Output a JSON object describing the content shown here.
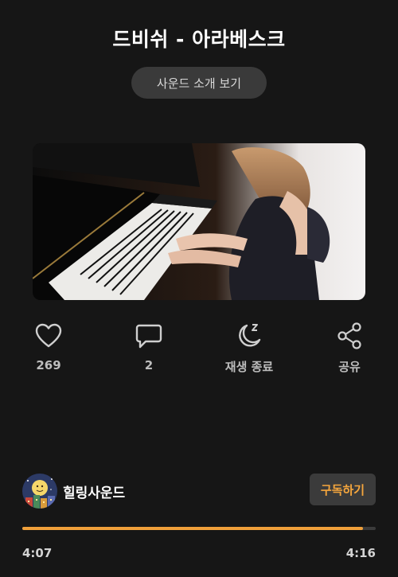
{
  "track": {
    "title": "드비쉬 - 아라베스크"
  },
  "intro_button": {
    "label": "사운드 소개 보기"
  },
  "actions": [
    {
      "icon": "heart-icon",
      "label": "269"
    },
    {
      "icon": "comment-icon",
      "label": "2"
    },
    {
      "icon": "sleep-timer-icon",
      "label": "재생 종료"
    },
    {
      "icon": "share-icon",
      "label": "공유"
    }
  ],
  "channel": {
    "name": "힐링사운드",
    "subscribe_label": "구독하기"
  },
  "player": {
    "current_time": "4:07",
    "total_time": "4:16",
    "progress": 0.965
  },
  "colors": {
    "accent": "#f0a03a",
    "background": "#161616"
  }
}
